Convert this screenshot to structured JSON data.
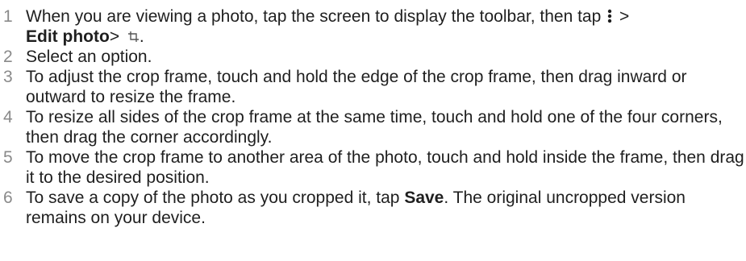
{
  "steps": [
    {
      "num": "1",
      "part_a": "When you are viewing a photo, tap the screen to display the toolbar, then tap",
      "part_b": " >",
      "bold_a": "Edit photo",
      "part_c": ">",
      "part_d": "."
    },
    {
      "num": "2",
      "text": "Select an option."
    },
    {
      "num": "3",
      "text": "To adjust the crop frame, touch and hold the edge of the crop frame, then drag inward or outward to resize the frame."
    },
    {
      "num": "4",
      "text": "To resize all sides of the crop frame at the same time, touch and hold one of the four corners, then drag the corner accordingly."
    },
    {
      "num": "5",
      "text": "To move the crop frame to another area of the photo, touch and hold inside the frame, then drag it to the desired position."
    },
    {
      "num": "6",
      "part_a": "To save a copy of the photo as you cropped it, tap ",
      "bold_a": "Save",
      "part_b": ". The original uncropped version remains on your device."
    }
  ],
  "icons": {
    "menu": "menu-icon",
    "crop": "crop-icon"
  },
  "colors": {
    "text": "#1f1f1f",
    "numbers": "#8a8a8a"
  }
}
